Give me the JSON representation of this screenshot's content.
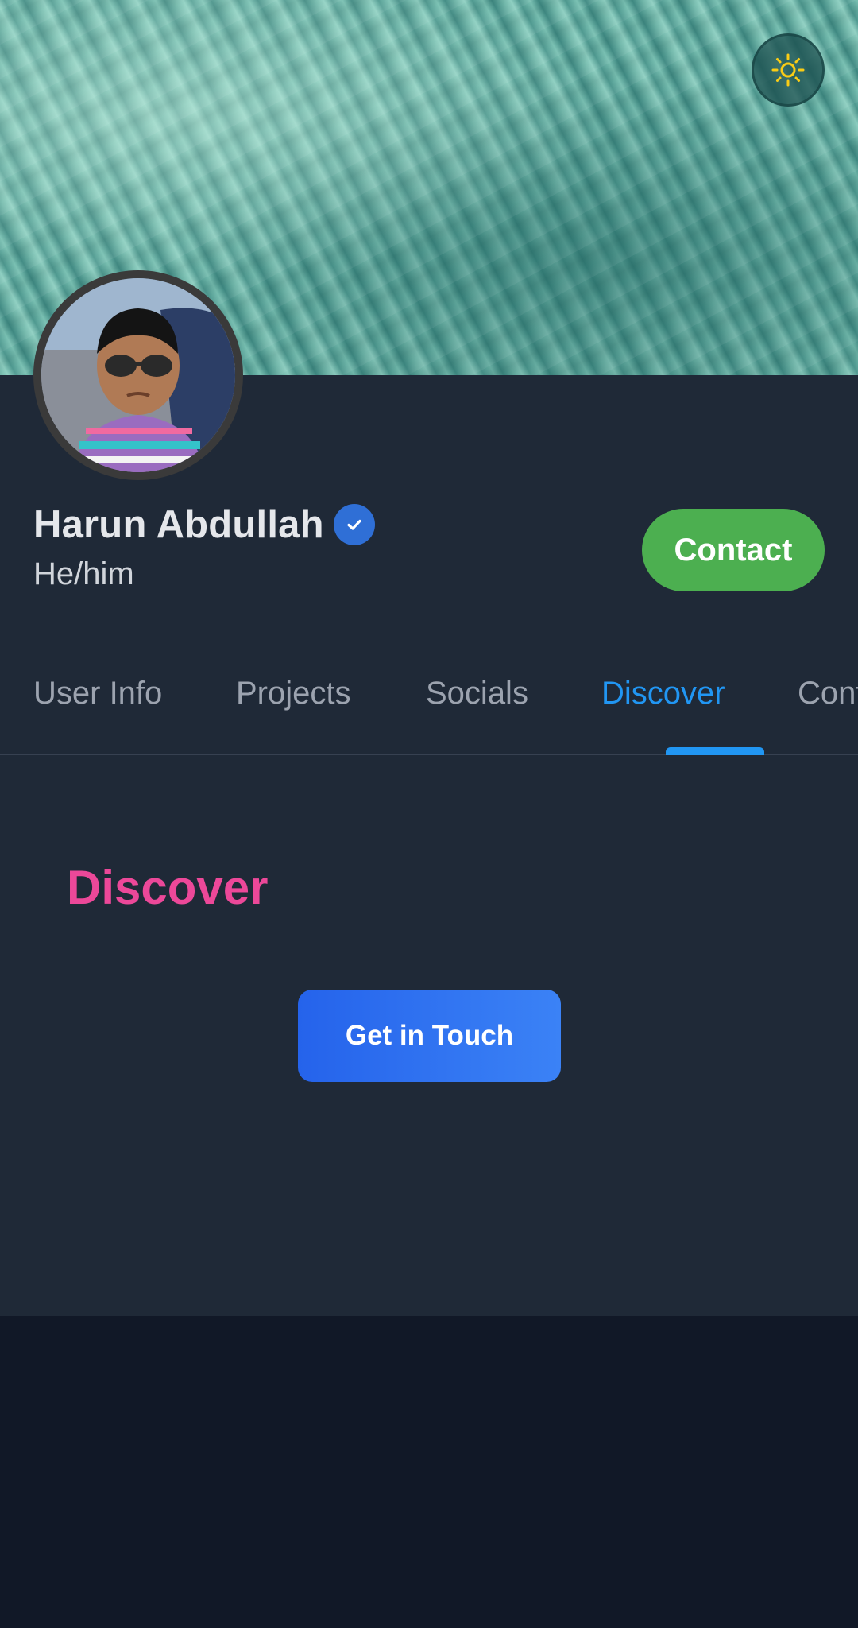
{
  "header": {
    "theme_toggle_icon": "sun-icon"
  },
  "profile": {
    "name": "Harun Abdullah",
    "verified_icon": "verified-check-icon",
    "pronouns": "He/him",
    "contact_label": "Contact"
  },
  "tabs": [
    {
      "label": "User Info",
      "active": false
    },
    {
      "label": "Projects",
      "active": false
    },
    {
      "label": "Socials",
      "active": false
    },
    {
      "label": "Discover",
      "active": true
    },
    {
      "label": "Contact",
      "active": false
    }
  ],
  "main": {
    "section_title": "Discover",
    "cta_label": "Get in Touch"
  },
  "colors": {
    "accent": "#2196f3",
    "contact_green": "#4caf50",
    "section_title_pink": "#ec4899",
    "card_bg": "#1f2937",
    "page_bg": "#111827"
  }
}
